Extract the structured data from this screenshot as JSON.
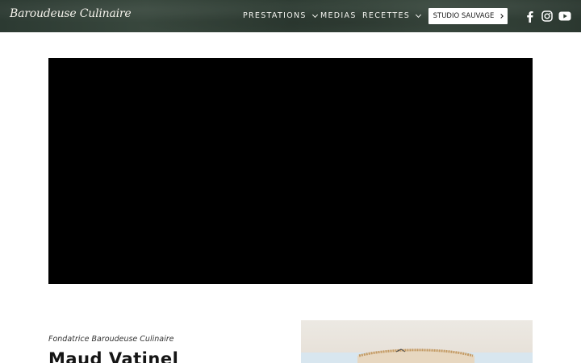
{
  "header": {
    "logo": "Baroudeuse Culinaire",
    "nav": [
      {
        "label": "PRESTATIONS",
        "dropdown": true
      },
      {
        "label": "MEDIAS",
        "dropdown": false
      },
      {
        "label": "RECETTES",
        "dropdown": true
      }
    ],
    "cta_label": "STUDIO SAUVAGE",
    "social": [
      "facebook-icon",
      "instagram-icon",
      "youtube-icon"
    ]
  },
  "colors": {
    "header_bg": "#2f3d34",
    "video_bg": "#000000",
    "cta_bg": "#ffffff"
  },
  "intro": {
    "eyebrow": "Fondatrice Baroudeuse Culinaire",
    "name": "Maud Vatinel"
  }
}
